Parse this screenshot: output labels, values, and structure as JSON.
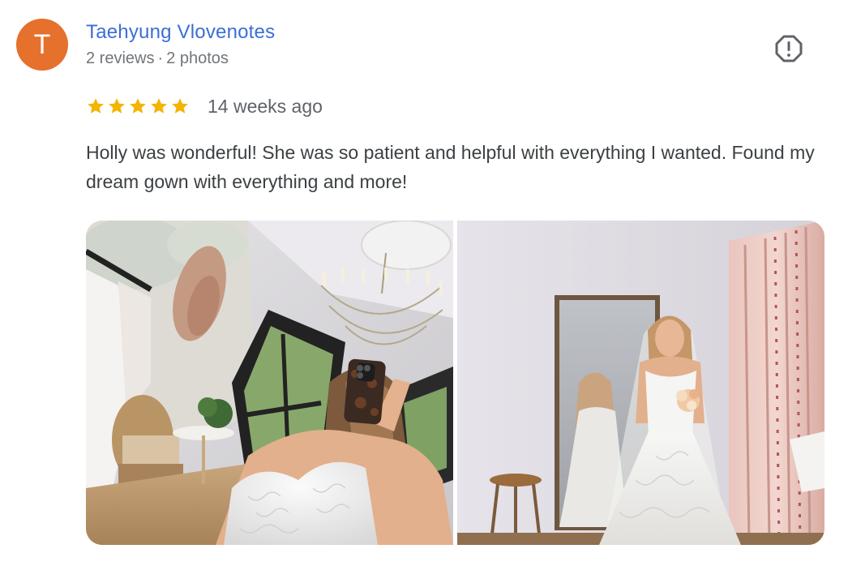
{
  "reviewer": {
    "initial": "T",
    "name": "Taehyung Vlovenotes",
    "review_count": "2 reviews",
    "separator": "·",
    "photo_count": "2 photos",
    "avatar_color": "#e5712c"
  },
  "review": {
    "rating": 5,
    "max_rating": 5,
    "time_ago": "14 weeks ago",
    "text": "Holly was wonderful! She was so patient and helpful with everything I wanted. Found my dream gown with everything and more!"
  },
  "photos": [
    {
      "icon": "bridal-selfie-photo"
    },
    {
      "icon": "bride-in-mirror-photo"
    }
  ],
  "colors": {
    "name_link": "#3b6fd4",
    "star": "#f4b400",
    "meta": "#70757a"
  },
  "actions": {
    "report_icon": "report-flag-icon"
  }
}
